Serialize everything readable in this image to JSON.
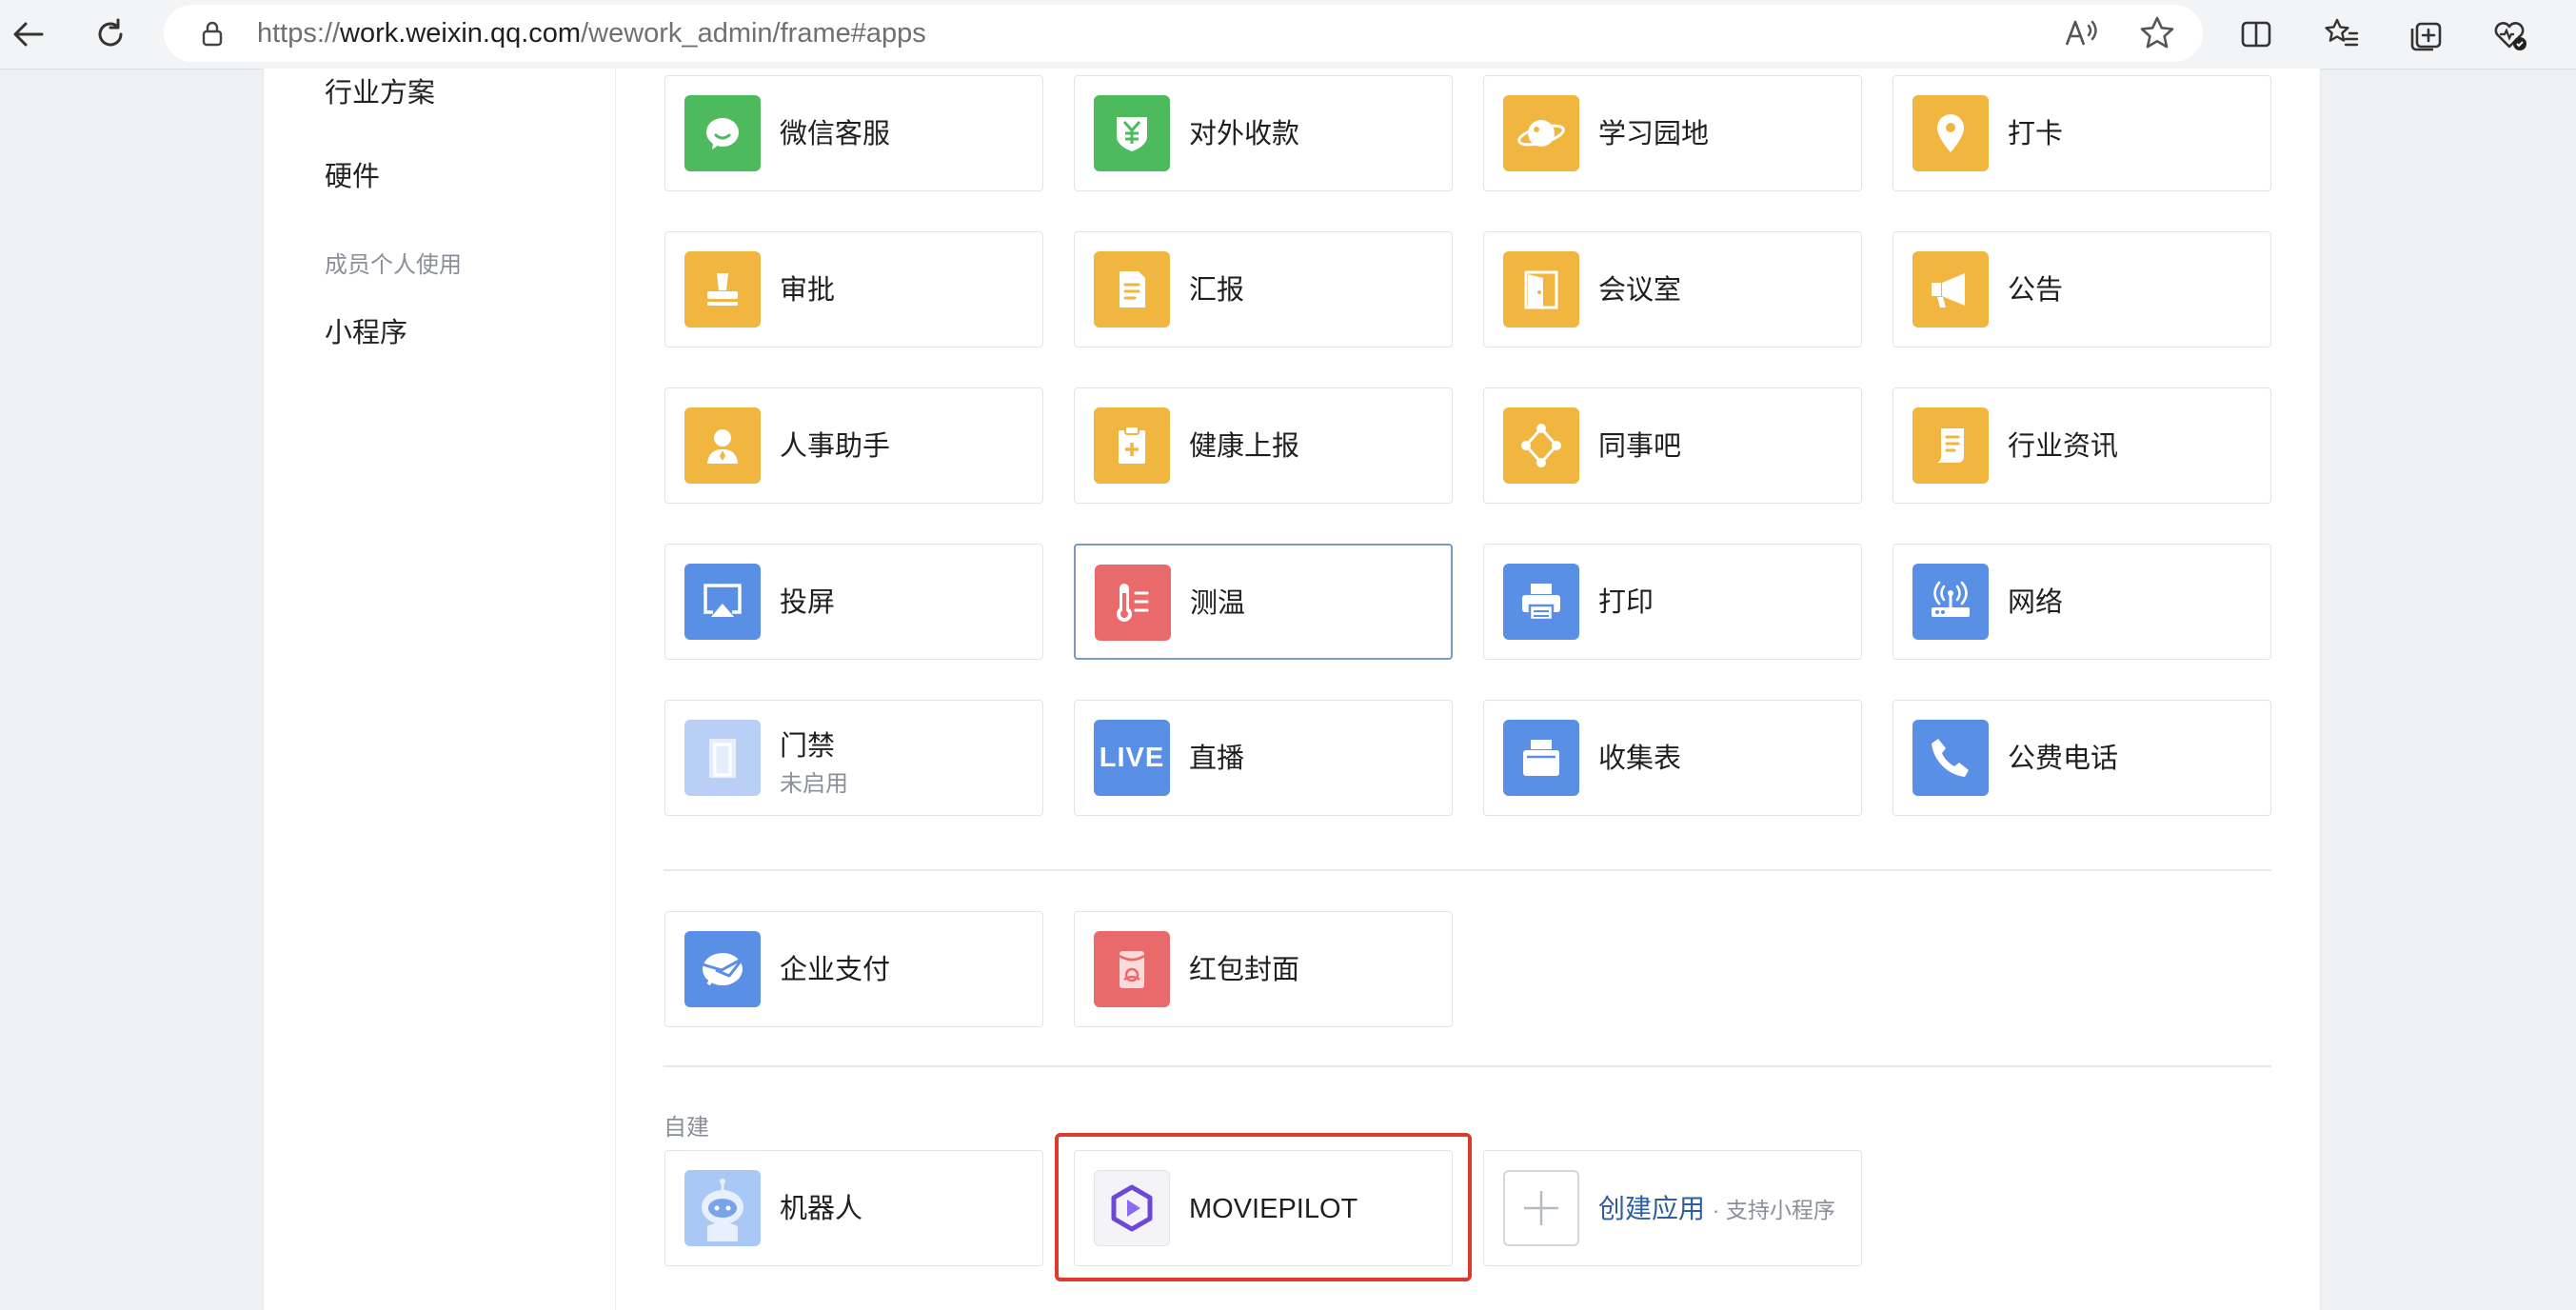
{
  "browser": {
    "url_prefix": "https://",
    "url_host": "work.weixin.qq.com",
    "url_path": "/wework_admin/frame#apps"
  },
  "sidebar": {
    "items_top": [
      "行业方案",
      "硬件"
    ],
    "category": "成员个人使用",
    "items_bottom": [
      "小程序"
    ]
  },
  "apps_basic": [
    {
      "name": "微信客服",
      "icon": "wechat-service-icon",
      "color": "#4dba5e"
    },
    {
      "name": "对外收款",
      "icon": "payment-collection-icon",
      "color": "#4dba5e"
    },
    {
      "name": "学习园地",
      "icon": "planet-icon",
      "color": "#f0b63f"
    },
    {
      "name": "打卡",
      "icon": "location-pin-icon",
      "color": "#f0b63f"
    },
    {
      "name": "审批",
      "icon": "stamp-icon",
      "color": "#f0b63f"
    },
    {
      "name": "汇报",
      "icon": "report-doc-icon",
      "color": "#f0b63f"
    },
    {
      "name": "会议室",
      "icon": "door-icon",
      "color": "#f0b63f"
    },
    {
      "name": "公告",
      "icon": "megaphone-icon",
      "color": "#f0b63f"
    },
    {
      "name": "人事助手",
      "icon": "person-icon",
      "color": "#f0b63f"
    },
    {
      "name": "健康上报",
      "icon": "clipboard-plus-icon",
      "color": "#f0b63f"
    },
    {
      "name": "同事吧",
      "icon": "network-nodes-icon",
      "color": "#f0b63f"
    },
    {
      "name": "行业资讯",
      "icon": "scroll-icon",
      "color": "#f0b63f"
    },
    {
      "name": "投屏",
      "icon": "airplay-icon",
      "color": "#5a8fe6"
    },
    {
      "name": "测温",
      "icon": "thermometer-icon",
      "color": "#e96a6a",
      "selected": true
    },
    {
      "name": "打印",
      "icon": "printer-icon",
      "color": "#5a8fe6"
    },
    {
      "name": "网络",
      "icon": "router-icon",
      "color": "#5a8fe6"
    },
    {
      "name": "门禁",
      "icon": "access-door-icon",
      "color": "#b9cff6",
      "status": "未启用"
    },
    {
      "name": "直播",
      "icon": "live-icon",
      "color": "#5a8fe6",
      "icon_text": "LIVE"
    },
    {
      "name": "收集表",
      "icon": "collection-form-icon",
      "color": "#5a8fe6"
    },
    {
      "name": "公费电话",
      "icon": "phone-icon",
      "color": "#5a8fe6"
    }
  ],
  "apps_pay": [
    {
      "name": "企业支付",
      "icon": "enterprise-pay-icon",
      "color": "#5a8fe6"
    },
    {
      "name": "红包封面",
      "icon": "red-packet-icon",
      "color": "#e96a6a"
    }
  ],
  "custom": {
    "label": "自建",
    "apps": [
      {
        "name": "机器人",
        "icon": "robot-icon",
        "color": "#a9c8f5"
      },
      {
        "name": "MOVIEPILOT",
        "icon": "moviepilot-logo-icon",
        "color": "#f4f4f8",
        "highlighted": true
      }
    ],
    "create": {
      "label": "创建应用",
      "tip": "· 支持小程序"
    }
  },
  "colors": {
    "accent": "#2c5d9e",
    "highlight": "#de3a2b"
  }
}
